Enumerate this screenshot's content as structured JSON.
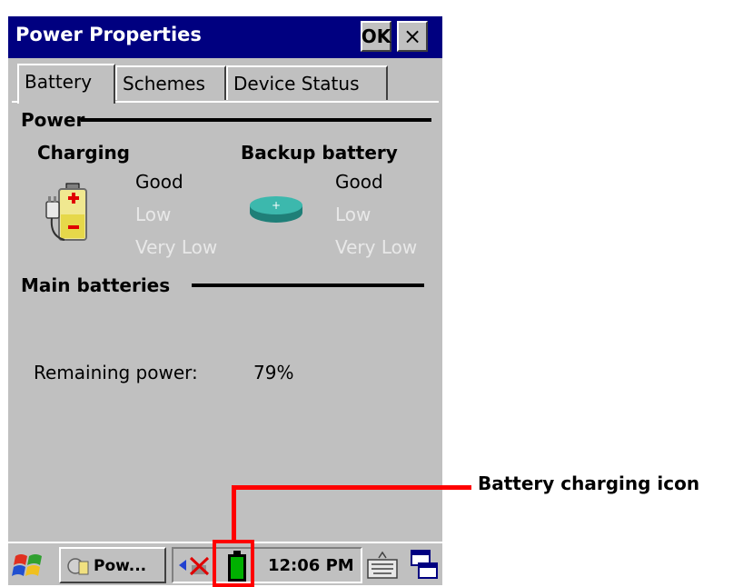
{
  "window": {
    "title": "Power Properties",
    "ok_label": "OK",
    "close_label": "×"
  },
  "tabs": [
    {
      "label": "Battery",
      "active": true
    },
    {
      "label": "Schemes",
      "active": false
    },
    {
      "label": "Device Status",
      "active": false
    }
  ],
  "power": {
    "section_label": "Power",
    "main": {
      "label": "Charging",
      "levels": [
        "Good",
        "Low",
        "Very Low"
      ],
      "active_level": "Good"
    },
    "backup": {
      "label": "Backup battery",
      "levels": [
        "Good",
        "Low",
        "Very Low"
      ],
      "active_level": "Good"
    }
  },
  "main_batteries": {
    "section_label": "Main batteries",
    "remaining_label": "Remaining power:",
    "remaining_value": "79%"
  },
  "taskbar": {
    "task_label": "Pow...",
    "clock": "12:06 PM"
  },
  "annotation": {
    "label": "Battery charging icon",
    "color": "#ff0000"
  },
  "colors": {
    "titlebar": "#000080",
    "window_bg": "#c0c0c0",
    "battery_green": "#00b000",
    "coin_teal": "#2aa198"
  }
}
